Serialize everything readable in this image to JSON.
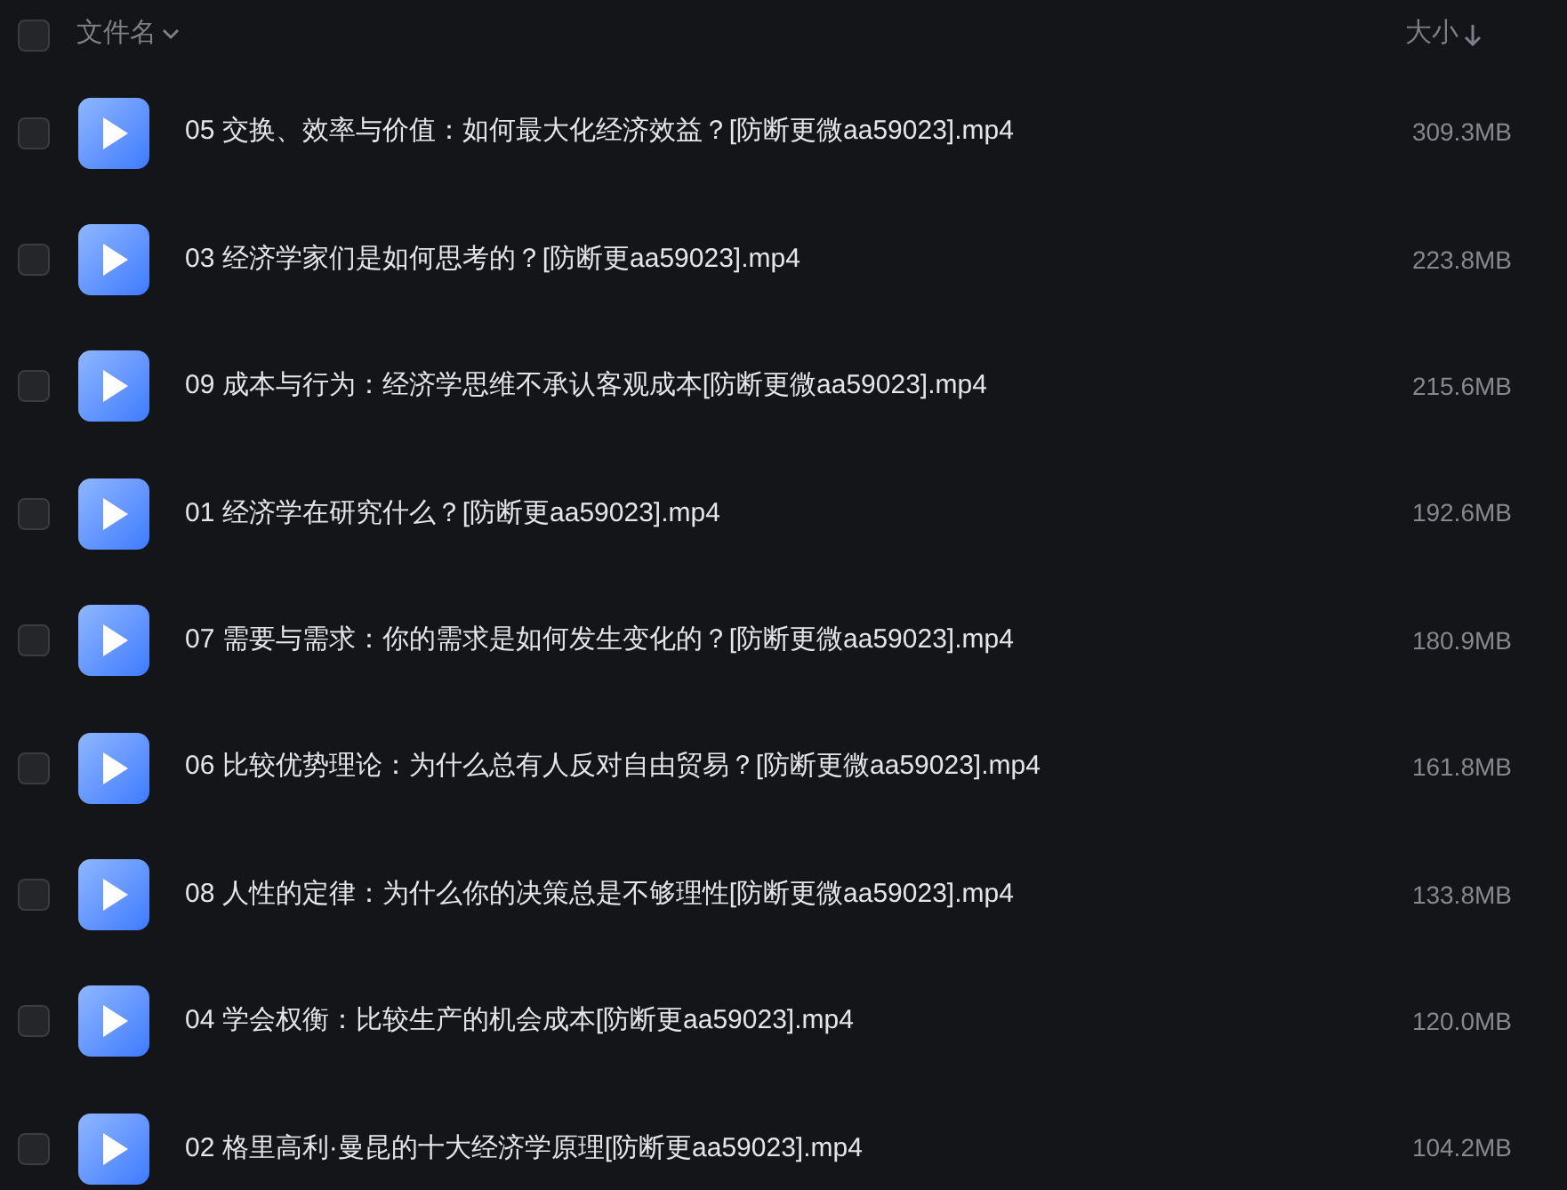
{
  "header": {
    "checked": false,
    "name_column": "文件名",
    "size_column": "大小"
  },
  "files": [
    {
      "checked": false,
      "name": "05 交换、效率与价值：如何最大化经济效益？[防断更微aa59023].mp4",
      "size": "309.3MB"
    },
    {
      "checked": false,
      "name": "03 经济学家们是如何思考的？[防断更aa59023].mp4",
      "size": "223.8MB"
    },
    {
      "checked": false,
      "name": "09 成本与行为：经济学思维不承认客观成本[防断更微aa59023].mp4",
      "size": "215.6MB"
    },
    {
      "checked": false,
      "name": "01 经济学在研究什么？[防断更aa59023].mp4",
      "size": "192.6MB"
    },
    {
      "checked": false,
      "name": "07 需要与需求：你的需求是如何发生变化的？[防断更微aa59023].mp4",
      "size": "180.9MB"
    },
    {
      "checked": false,
      "name": "06 比较优势理论：为什么总有人反对自由贸易？[防断更微aa59023].mp4",
      "size": "161.8MB"
    },
    {
      "checked": false,
      "name": "08 人性的定律：为什么你的决策总是不够理性[防断更微aa59023].mp4",
      "size": "133.8MB"
    },
    {
      "checked": false,
      "name": "04 学会权衡：比较生产的机会成本[防断更aa59023].mp4",
      "size": "120.0MB"
    },
    {
      "checked": false,
      "name": "02 格里高利·曼昆的十大经济学原理[防断更aa59023].mp4",
      "size": "104.2MB"
    }
  ]
}
